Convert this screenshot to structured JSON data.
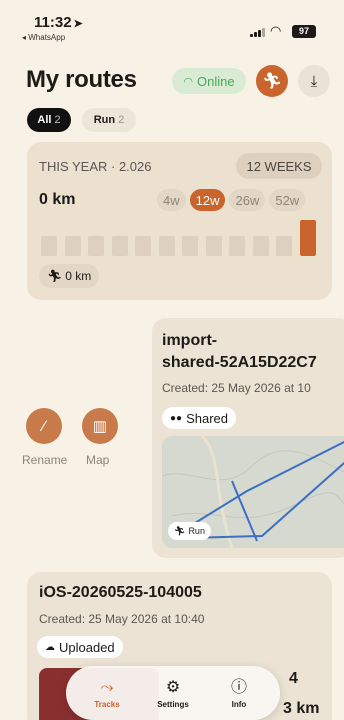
{
  "status_bar": {
    "time": "11:32",
    "back_app": "◂ WhatsApp",
    "battery": "97"
  },
  "header": {
    "title": "My routes",
    "online_label": "Online"
  },
  "filters": [
    {
      "label": "All",
      "count": "2"
    },
    {
      "label": "Run",
      "count": "2"
    }
  ],
  "stats": {
    "year_label": "THIS YEAR · 2.026",
    "weeks_label": "12 WEEKS",
    "distance": "0 km",
    "periods": [
      "4w",
      "12w",
      "26w",
      "52w"
    ],
    "selected_period": "12w",
    "weekly_km": [
      0,
      0,
      0,
      0,
      0,
      0,
      0,
      0,
      0,
      0,
      0,
      0
    ],
    "total_label": "0 km",
    "colors": {
      "empty_bar": "#ddd0be",
      "current_bar": "#c8642c"
    }
  },
  "swipe_actions": [
    {
      "label": "Rename",
      "icon": "pencil-icon"
    },
    {
      "label": "Map",
      "icon": "map-icon"
    }
  ],
  "routes": [
    {
      "title": "import-\nshared-52A15D22C7",
      "created": "Created: 25 May 2026 at 10",
      "badge": "Shared",
      "sport": "Run"
    },
    {
      "title": "iOS-20260525-104005",
      "created": "Created: 25 May 2026 at 10:40",
      "badge": "Uploaded",
      "stat_a": "4",
      "stat_b": "3 km"
    }
  ],
  "tabbar": [
    {
      "label": "Tracks",
      "icon": "route-icon",
      "active": true
    },
    {
      "label": "Settings",
      "icon": "gear-icon",
      "active": false
    },
    {
      "label": "Info",
      "icon": "info-icon",
      "active": false
    }
  ]
}
